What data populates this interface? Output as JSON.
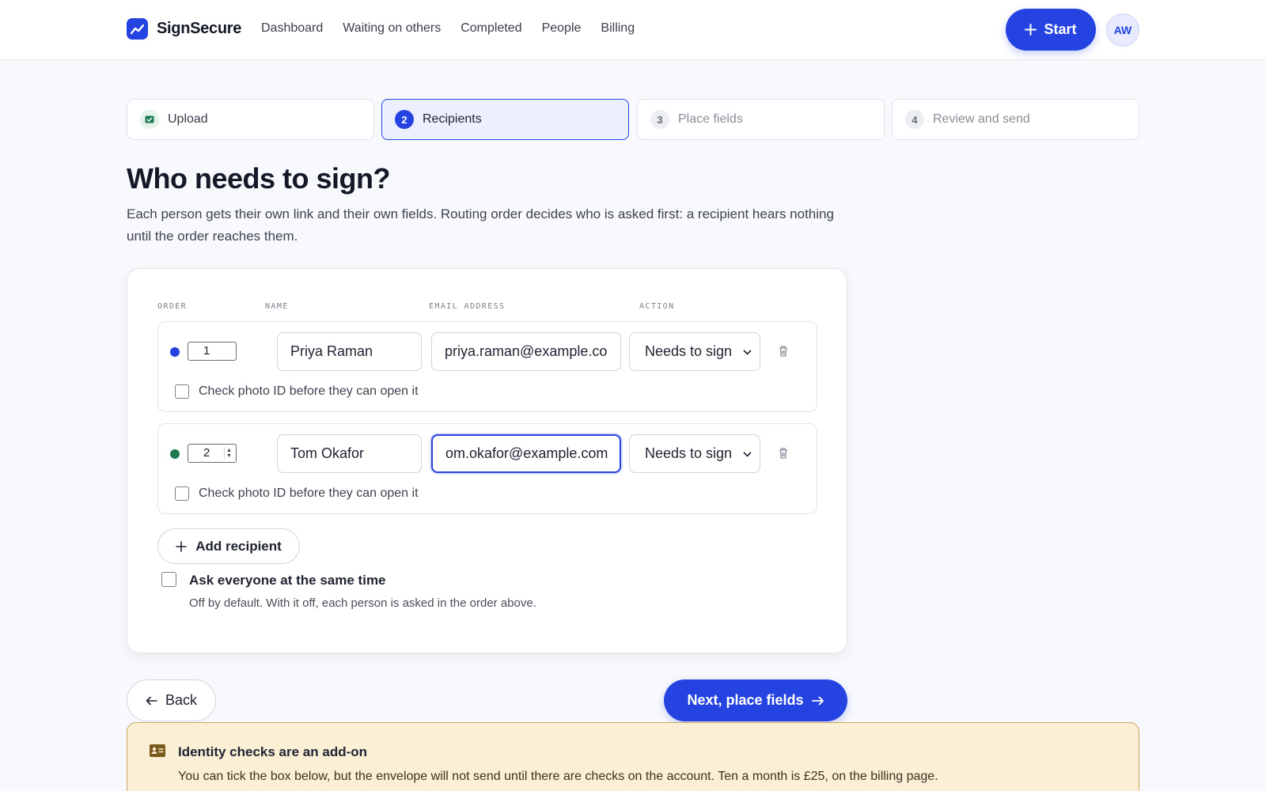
{
  "app": {
    "name": "SignSecure"
  },
  "nav": {
    "items": [
      "Dashboard",
      "Waiting on others",
      "Completed",
      "People",
      "Billing"
    ]
  },
  "header": {
    "start_label": "Start",
    "avatar_initials": "AW"
  },
  "steps": [
    {
      "num": "",
      "label": "Upload",
      "state": "done"
    },
    {
      "num": "2",
      "label": "Recipients",
      "state": "active"
    },
    {
      "num": "3",
      "label": "Place fields",
      "state": "pending"
    },
    {
      "num": "4",
      "label": "Review and send",
      "state": "pending"
    }
  ],
  "page": {
    "title": "Who needs to sign?",
    "subtitle": "Each person gets their own link and their own fields. Routing order decides who is asked first: a recipient hears nothing until the order reaches them."
  },
  "table": {
    "headers": {
      "order": "ORDER",
      "name": "NAME",
      "email": "EMAIL ADDRESS",
      "action": "ACTION"
    },
    "recipients": [
      {
        "order": "1",
        "name": "Priya Raman",
        "email": "priya.raman@example.co",
        "action": "Needs to sign",
        "color": "#2443e0",
        "photo_id_label": "Check photo ID before they can open it",
        "photo_id_checked": false
      },
      {
        "order": "2",
        "name": "Tom Okafor",
        "email": "om.okafor@example.com",
        "action": "Needs to sign",
        "color": "#1f7a4f",
        "photo_id_label": "Check photo ID before they can open it",
        "photo_id_checked": false
      }
    ],
    "add_label": "Add recipient"
  },
  "same_time": {
    "title": "Ask everyone at the same time",
    "sub": "Off by default. With it off, each person is asked in the order above.",
    "checked": false
  },
  "footer": {
    "back_label": "Back",
    "next_label": "Next, place fields"
  },
  "notice": {
    "title": "Identity checks are an add-on",
    "text": "You can tick the box below, but the envelope will not send until there are checks on the account. Ten a month is £25, on the billing page."
  },
  "colors": {
    "accent": "#2443e0",
    "success": "#1f7a4f",
    "notice_bg": "#fbf0d6"
  }
}
